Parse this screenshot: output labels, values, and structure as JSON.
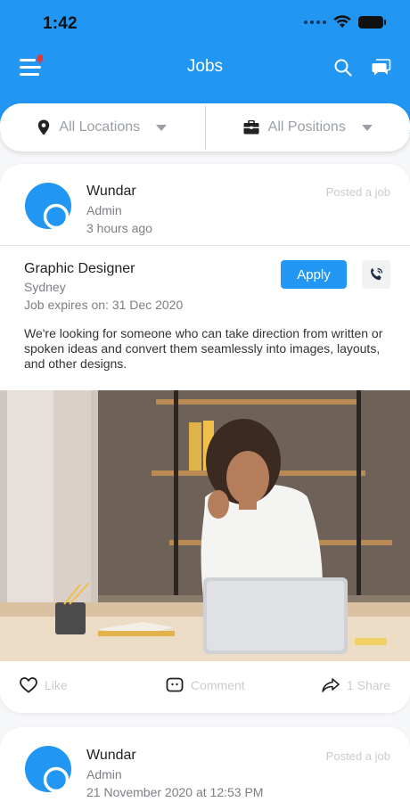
{
  "status_bar": {
    "time": "1:42"
  },
  "header": {
    "title": "Jobs"
  },
  "filters": {
    "location_label": "All Locations",
    "position_label": "All Positions"
  },
  "posts": [
    {
      "poster_name": "Wundar",
      "poster_role": "Admin",
      "time_ago": "3 hours ago",
      "post_type": "Posted a job",
      "job_title": "Graphic Designer",
      "location": "Sydney",
      "expiry": "Job expires on: 31 Dec 2020",
      "apply_label": "Apply",
      "description": "We're looking for someone who can take direction from written or spoken ideas and convert them seamlessly into images, layouts, and other designs.",
      "like_label": "Like",
      "comment_label": "Comment",
      "share_label": "1 Share"
    },
    {
      "poster_name": "Wundar",
      "poster_role": "Admin",
      "time_ago": "21 November 2020 at 12:53 PM",
      "post_type": "Posted a job"
    }
  ],
  "icons": {
    "menu": "menu-icon",
    "notification": "notification-badge-icon",
    "search": "search-icon",
    "chat": "chat-icon",
    "location": "location-pin-icon",
    "briefcase": "briefcase-icon",
    "call": "phone-icon",
    "like": "heart-icon",
    "comment": "comment-icon",
    "share": "share-icon"
  },
  "colors": {
    "brand": "#2196f3",
    "notification": "#e53935",
    "muted_text": "#7b7f84",
    "faint_text": "#c9ccd0"
  }
}
